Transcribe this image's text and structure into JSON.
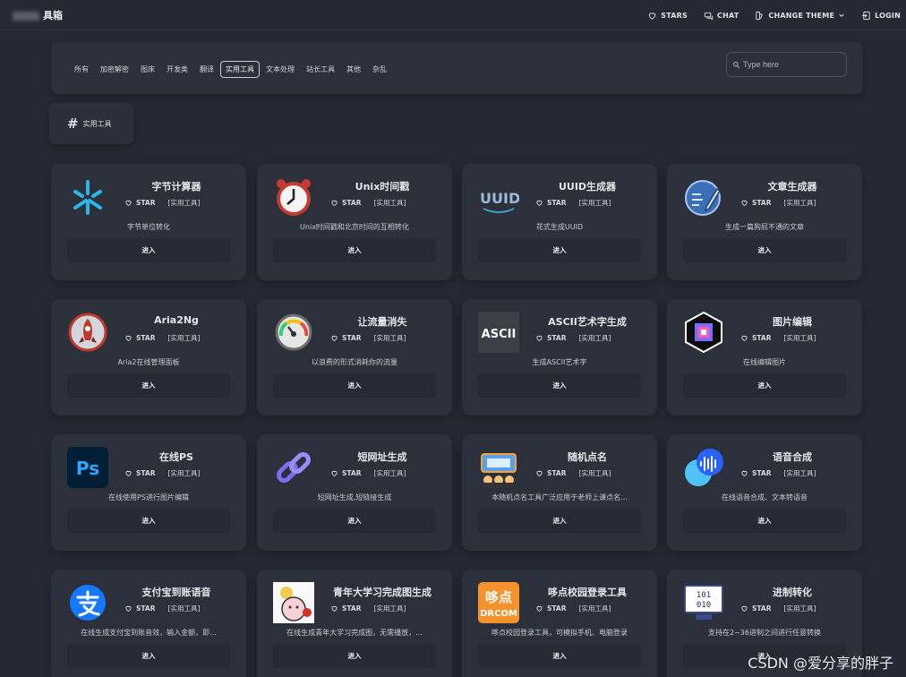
{
  "header": {
    "brand": "具箱",
    "nav": [
      {
        "label": "STARS",
        "icon": "heart-icon"
      },
      {
        "label": "CHAT",
        "icon": "chat-icon"
      },
      {
        "label": "CHANGE THEME",
        "icon": "theme-icon"
      },
      {
        "label": "LOGIN",
        "icon": "login-icon"
      }
    ]
  },
  "filters": {
    "tabs": [
      "所有",
      "加密解密",
      "图床",
      "开发类",
      "翻译",
      "实用工具",
      "文本处理",
      "站长工具",
      "其他",
      "杂乱"
    ],
    "active_tab": "实用工具",
    "search_placeholder": "Type here"
  },
  "section": {
    "title": "实用工具"
  },
  "cards": [
    {
      "title": "字节计算器",
      "star": "STAR",
      "tag": "[实用工具]",
      "desc": "字节单位转化",
      "button": "进入",
      "icon": "byte-calculator-icon"
    },
    {
      "title": "Unix时间戳",
      "star": "STAR",
      "tag": "[实用工具]",
      "desc": "Unix时间戳和北京时间的互相转化",
      "button": "进入",
      "icon": "alarm-clock-icon"
    },
    {
      "title": "UUID生成器",
      "star": "STAR",
      "tag": "[实用工具]",
      "desc": "花式生成UUID",
      "button": "进入",
      "icon": "uuid-icon"
    },
    {
      "title": "文章生成器",
      "star": "STAR",
      "tag": "[实用工具]",
      "desc": "生成一篇狗屁不通的文章",
      "button": "进入",
      "icon": "article-pen-icon"
    },
    {
      "title": "Aria2Ng",
      "star": "STAR",
      "tag": "[实用工具]",
      "desc": "Aria2在线管理面板",
      "button": "进入",
      "icon": "rocket-icon"
    },
    {
      "title": "让流量消失",
      "star": "STAR",
      "tag": "[实用工具]",
      "desc": "以浪费的形式消耗你的流量",
      "button": "进入",
      "icon": "gauge-icon"
    },
    {
      "title": "ASCII艺术字生成",
      "star": "STAR",
      "tag": "[实用工具]",
      "desc": "生成ASCII艺术字",
      "button": "进入",
      "icon": "ascii-icon"
    },
    {
      "title": "图片编辑",
      "star": "STAR",
      "tag": "[实用工具]",
      "desc": "在线编辑图片",
      "button": "进入",
      "icon": "image-editor-icon"
    },
    {
      "title": "在线PS",
      "star": "STAR",
      "tag": "[实用工具]",
      "desc": "在线使用PS进行图片编辑",
      "button": "进入",
      "icon": "photoshop-icon"
    },
    {
      "title": "短网址生成",
      "star": "STAR",
      "tag": "[实用工具]",
      "desc": "短网址生成,短链接生成",
      "button": "进入",
      "icon": "link-icon"
    },
    {
      "title": "随机点名",
      "star": "STAR",
      "tag": "[实用工具]",
      "desc": "本随机点名工具广泛应用于老师上课点名...",
      "button": "进入",
      "icon": "roll-call-icon"
    },
    {
      "title": "语音合成",
      "star": "STAR",
      "tag": "[实用工具]",
      "desc": "在线语音合成、文本转语音",
      "button": "进入",
      "icon": "voice-wave-icon"
    },
    {
      "title": "支付宝到账语音",
      "star": "STAR",
      "tag": "[实用工具]",
      "desc": "在线生成支付宝到账音效，输入金额，即...",
      "button": "进入",
      "icon": "alipay-icon"
    },
    {
      "title": "青年大学习完成图生成",
      "star": "STAR",
      "tag": "[实用工具]",
      "desc": "在线生成青年大学习完成图，无需播放，...",
      "button": "进入",
      "icon": "cartoon-icon"
    },
    {
      "title": "哆点校园登录工具",
      "star": "STAR",
      "tag": "[实用工具]",
      "desc": "哆点校园登录工具，可模拟手机、电脑登录",
      "button": "进入",
      "icon": "duodian-icon"
    },
    {
      "title": "进制转化",
      "star": "STAR",
      "tag": "[实用工具]",
      "desc": "支持在2~36进制之间进行任意转换",
      "button": "进入",
      "icon": "binary-monitor-icon"
    }
  ],
  "watermark": "CSDN @爱分享的胖子",
  "icon_text": {
    "ascii": "ASCII",
    "ps": "Ps",
    "duodian_top": "哆点",
    "duodian_bottom": "DRCOM",
    "binary_top": "101",
    "binary_bottom": "010"
  }
}
